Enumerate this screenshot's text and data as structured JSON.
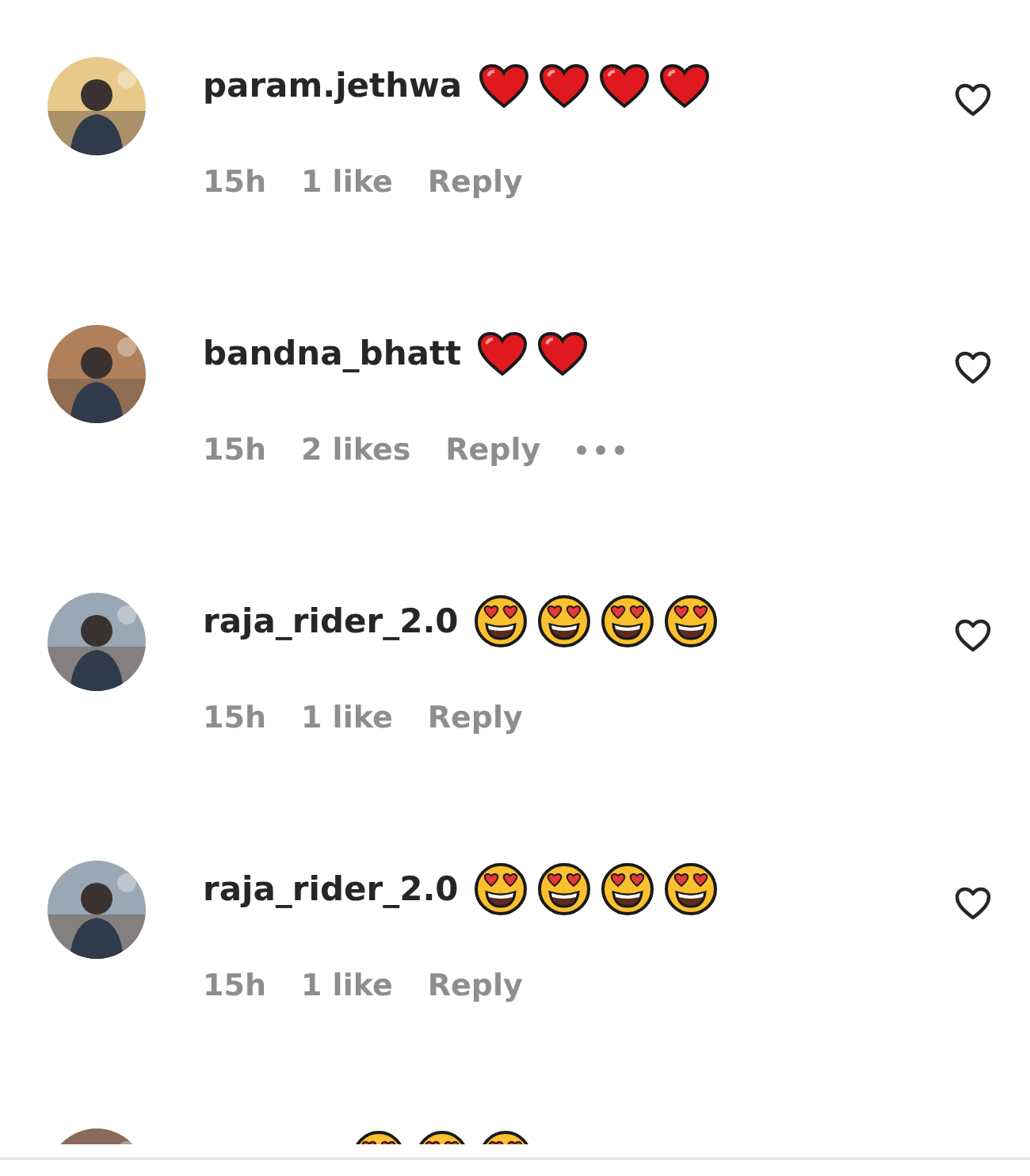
{
  "comments": [
    {
      "username": "param.jethwa",
      "emojis": [
        {
          "kind": "heart"
        },
        {
          "kind": "heart"
        },
        {
          "kind": "heart"
        },
        {
          "kind": "heart"
        }
      ],
      "time": "15h",
      "likes": "1 like",
      "reply": "Reply",
      "more": false
    },
    {
      "username": "bandna_bhatt",
      "emojis": [
        {
          "kind": "heart"
        },
        {
          "kind": "heart"
        }
      ],
      "time": "15h",
      "likes": "2 likes",
      "reply": "Reply",
      "more": true
    },
    {
      "username": "raja_rider_2.0",
      "emojis": [
        {
          "kind": "heart_eyes"
        },
        {
          "kind": "heart_eyes"
        },
        {
          "kind": "heart_eyes"
        },
        {
          "kind": "heart_eyes"
        }
      ],
      "time": "15h",
      "likes": "1 like",
      "reply": "Reply",
      "more": false
    },
    {
      "username": "raja_rider_2.0",
      "emojis": [
        {
          "kind": "heart_eyes"
        },
        {
          "kind": "heart_eyes"
        },
        {
          "kind": "heart_eyes"
        },
        {
          "kind": "heart_eyes"
        }
      ],
      "time": "15h",
      "likes": "1 like",
      "reply": "Reply",
      "more": false
    }
  ],
  "cut_off_comment": {
    "emojis": [
      {
        "kind": "heart_eyes"
      },
      {
        "kind": "heart_eyes"
      },
      {
        "kind": "heart_eyes"
      }
    ]
  }
}
